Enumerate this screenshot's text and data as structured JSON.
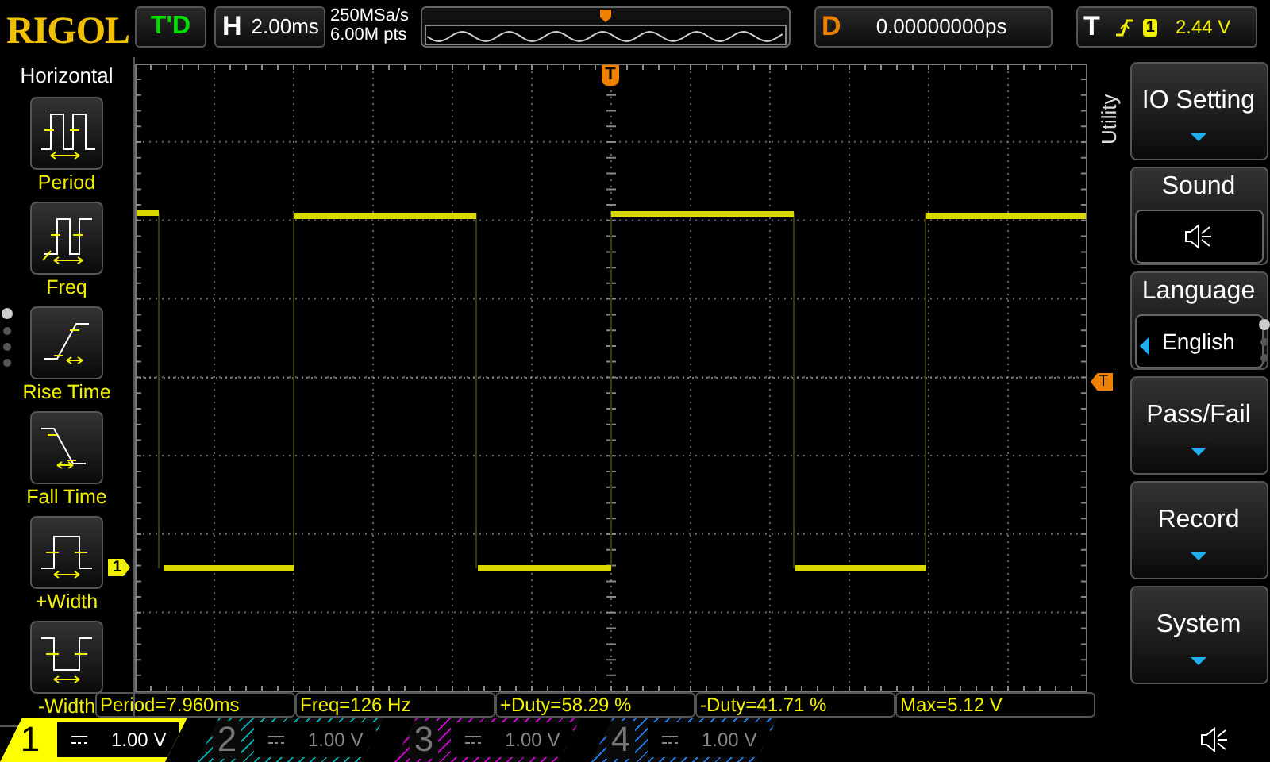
{
  "header": {
    "logo": "RIGOL",
    "run_status": "T'D",
    "horizontal": {
      "label": "H",
      "value": "2.00ms"
    },
    "sample_rate": "250MSa/s",
    "memory_depth": "6.00M pts",
    "delay": {
      "label": "D",
      "value": "0.00000000ps"
    },
    "trigger": {
      "label": "T",
      "source": "1",
      "level": "2.44 V"
    }
  },
  "left_menu": {
    "title": "Horizontal",
    "items": [
      {
        "label": "Period"
      },
      {
        "label": "Freq"
      },
      {
        "label": "Rise Time"
      },
      {
        "label": "Fall Time"
      },
      {
        "label": "+Width"
      },
      {
        "label": "-Width"
      }
    ],
    "pages": [
      {
        "selected": true
      },
      {
        "selected": false
      },
      {
        "selected": false
      },
      {
        "selected": false
      }
    ]
  },
  "display": {
    "channel_marker": "1",
    "trigger_position_marker": "T",
    "trigger_level_marker": "T"
  },
  "right_menu": {
    "title": "Utility",
    "items": [
      {
        "kind": "submenu",
        "label": "IO Setting"
      },
      {
        "kind": "toggle",
        "label": "Sound"
      },
      {
        "kind": "choice",
        "label": "Language",
        "value": "English"
      },
      {
        "kind": "submenu",
        "label": "Pass/Fail"
      },
      {
        "kind": "submenu",
        "label": "Record"
      },
      {
        "kind": "submenu",
        "label": "System"
      }
    ],
    "pages": [
      {
        "selected": true
      },
      {
        "selected": false
      },
      {
        "selected": false
      }
    ]
  },
  "measurements": [
    "Period=7.960ms",
    "Freq=126 Hz",
    "+Duty=58.29 %",
    "-Duty=41.71 %",
    "Max=5.12 V"
  ],
  "channels": [
    {
      "number": "1",
      "scale": "1.00 V",
      "active": true,
      "color": "#ffff00"
    },
    {
      "number": "2",
      "scale": "1.00 V",
      "active": false,
      "color": "#00a0a0"
    },
    {
      "number": "3",
      "scale": "1.00 V",
      "active": false,
      "color": "#c000c0"
    },
    {
      "number": "4",
      "scale": "1.00 V",
      "active": false,
      "color": "#1e6fd0"
    }
  ]
}
